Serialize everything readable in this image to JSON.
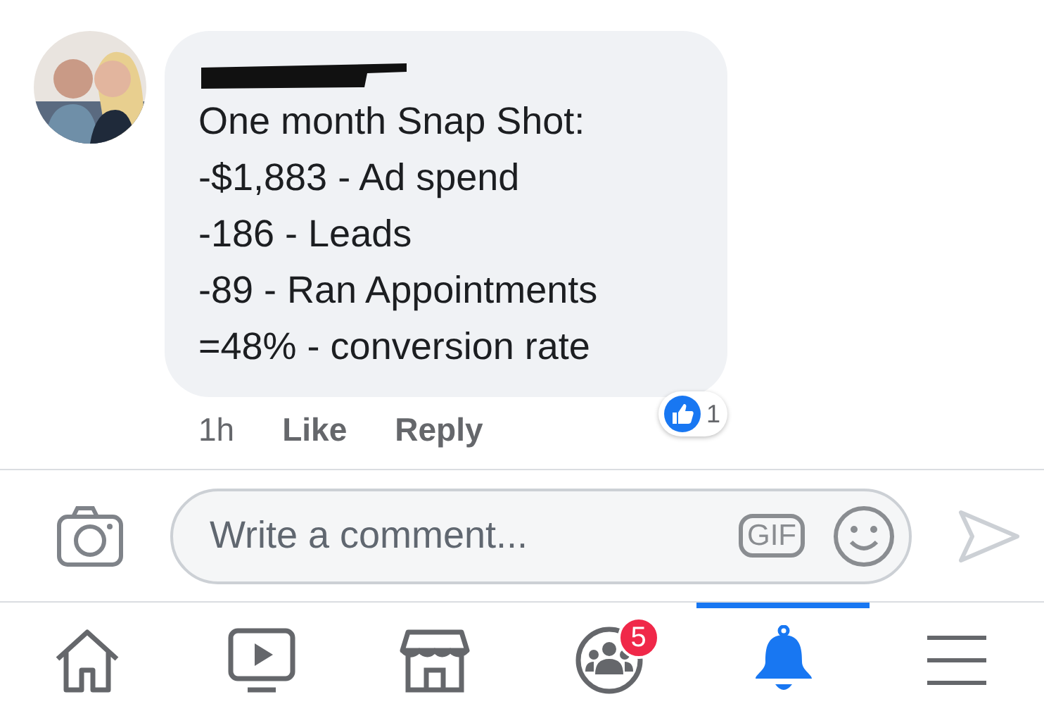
{
  "comment": {
    "lines": [
      "One month Snap Shot:",
      "-$1,883 - Ad spend",
      "-186 - Leads",
      "-89 - Ran Appointments",
      "=48% -  conversion rate"
    ],
    "name_redacted": true,
    "time": "1h",
    "actions": [
      "Like",
      "Reply"
    ],
    "reaction_count": "1"
  },
  "composer": {
    "placeholder": "Write a comment...",
    "gif": "GIF"
  },
  "tabs": [
    {
      "kind": "home",
      "selected": false
    },
    {
      "kind": "video",
      "selected": false
    },
    {
      "kind": "market",
      "selected": false
    },
    {
      "kind": "groups",
      "selected": false,
      "badge": "5"
    },
    {
      "kind": "bell",
      "selected": true
    },
    {
      "kind": "menu",
      "selected": false
    }
  ]
}
